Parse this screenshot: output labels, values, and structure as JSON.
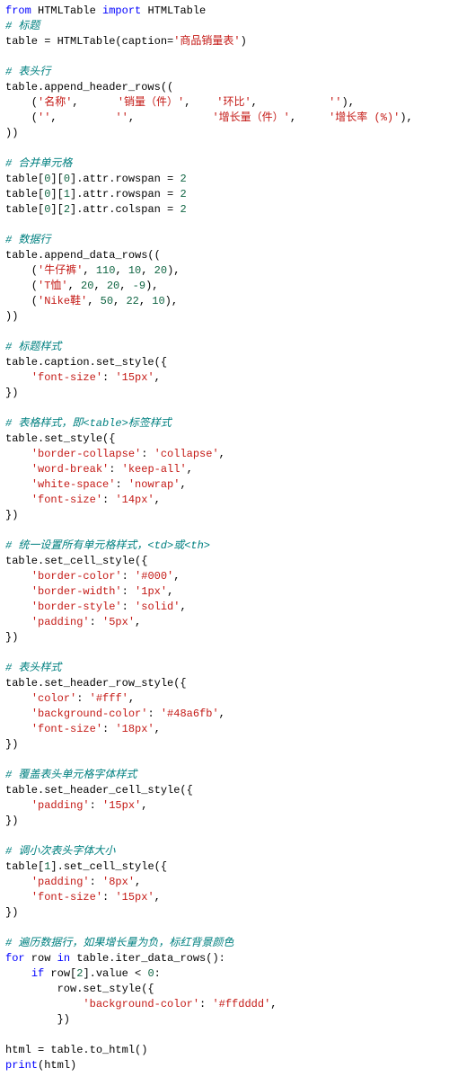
{
  "code": {
    "l1": {
      "kw1": "from",
      "mod": " HTMLTable ",
      "kw2": "import",
      "cls": " HTMLTable"
    },
    "c2": "# 标题",
    "l3": {
      "a": "table = HTMLTable(caption=",
      "s": "'商品销量表'",
      "b": ")"
    },
    "c5": "# 表头行",
    "l6": "table.append_header_rows((",
    "l7": {
      "p": "    (",
      "s1": "'名称'",
      "c1": ",      ",
      "s2": "'销量（件）'",
      "c2": ",    ",
      "s3": "'环比'",
      "c3": ",           ",
      "s4": "''",
      "c4": "),"
    },
    "l8": {
      "p": "    (",
      "s1": "''",
      "c1": ",         ",
      "s2": "''",
      "c2": ",            ",
      "s3": "'增长量（件）'",
      "c3": ",     ",
      "s4": "'增长率 (%)'",
      "c4": "),"
    },
    "l9": "))",
    "c11": "# 合并单元格",
    "l12": {
      "a": "table[",
      "n1": "0",
      "b": "][",
      "n2": "0",
      "c": "].attr.rowspan = ",
      "n3": "2"
    },
    "l13": {
      "a": "table[",
      "n1": "0",
      "b": "][",
      "n2": "1",
      "c": "].attr.rowspan = ",
      "n3": "2"
    },
    "l14": {
      "a": "table[",
      "n1": "0",
      "b": "][",
      "n2": "2",
      "c": "].attr.colspan = ",
      "n3": "2"
    },
    "c16": "# 数据行",
    "l17": "table.append_data_rows((",
    "l18": {
      "p": "    (",
      "s": "'牛仔裤'",
      "c1": ", ",
      "n1": "110",
      "c2": ", ",
      "n2": "10",
      "c3": ", ",
      "n3": "20",
      "e": "),"
    },
    "l19": {
      "p": "    (",
      "s": "'T恤'",
      "c1": ", ",
      "n1": "20",
      "c2": ", ",
      "n2": "20",
      "c3": ", ",
      "n3": "-9",
      "e": "),"
    },
    "l20": {
      "p": "    (",
      "s": "'Nike鞋'",
      "c1": ", ",
      "n1": "50",
      "c2": ", ",
      "n2": "22",
      "c3": ", ",
      "n3": "10",
      "e": "),"
    },
    "l21": "))",
    "c23": "# 标题样式",
    "l24": "table.caption.set_style({",
    "l25": {
      "p": "    ",
      "k": "'font-size'",
      "c": ": ",
      "v": "'15px'",
      "e": ","
    },
    "l26": "})",
    "c28": "# 表格样式，即<table>标签样式",
    "l29": "table.set_style({",
    "l30": {
      "p": "    ",
      "k": "'border-collapse'",
      "c": ": ",
      "v": "'collapse'",
      "e": ","
    },
    "l31": {
      "p": "    ",
      "k": "'word-break'",
      "c": ": ",
      "v": "'keep-all'",
      "e": ","
    },
    "l32": {
      "p": "    ",
      "k": "'white-space'",
      "c": ": ",
      "v": "'nowrap'",
      "e": ","
    },
    "l33": {
      "p": "    ",
      "k": "'font-size'",
      "c": ": ",
      "v": "'14px'",
      "e": ","
    },
    "l34": "})",
    "c36": "# 统一设置所有单元格样式，<td>或<th>",
    "l37": "table.set_cell_style({",
    "l38": {
      "p": "    ",
      "k": "'border-color'",
      "c": ": ",
      "v": "'#000'",
      "e": ","
    },
    "l39": {
      "p": "    ",
      "k": "'border-width'",
      "c": ": ",
      "v": "'1px'",
      "e": ","
    },
    "l40": {
      "p": "    ",
      "k": "'border-style'",
      "c": ": ",
      "v": "'solid'",
      "e": ","
    },
    "l41": {
      "p": "    ",
      "k": "'padding'",
      "c": ": ",
      "v": "'5px'",
      "e": ","
    },
    "l42": "})",
    "c44": "# 表头样式",
    "l45": "table.set_header_row_style({",
    "l46": {
      "p": "    ",
      "k": "'color'",
      "c": ": ",
      "v": "'#fff'",
      "e": ","
    },
    "l47": {
      "p": "    ",
      "k": "'background-color'",
      "c": ": ",
      "v": "'#48a6fb'",
      "e": ","
    },
    "l48": {
      "p": "    ",
      "k": "'font-size'",
      "c": ": ",
      "v": "'18px'",
      "e": ","
    },
    "l49": "})",
    "c51": "# 覆盖表头单元格字体样式",
    "l52": "table.set_header_cell_style({",
    "l53": {
      "p": "    ",
      "k": "'padding'",
      "c": ": ",
      "v": "'15px'",
      "e": ","
    },
    "l54": "})",
    "c56": "# 调小次表头字体大小",
    "l57": {
      "a": "table[",
      "n": "1",
      "b": "].set_cell_style({"
    },
    "l58": {
      "p": "    ",
      "k": "'padding'",
      "c": ": ",
      "v": "'8px'",
      "e": ","
    },
    "l59": {
      "p": "    ",
      "k": "'font-size'",
      "c": ": ",
      "v": "'15px'",
      "e": ","
    },
    "l60": "})",
    "c62": "# 遍历数据行，如果增长量为负，标红背景颜色",
    "l63": {
      "kw1": "for",
      "a": " row ",
      "kw2": "in",
      "b": " table.iter_data_rows():"
    },
    "l64": {
      "p": "    ",
      "kw": "if",
      "a": " row[",
      "n1": "2",
      "b": "].value < ",
      "n2": "0",
      "c": ":"
    },
    "l65": "        row.set_style({",
    "l66": {
      "p": "            ",
      "k": "'background-color'",
      "c": ": ",
      "v": "'#ffdddd'",
      "e": ","
    },
    "l67": "        })",
    "l69": "html = table.to_html()",
    "l70": {
      "fn": "print",
      "a": "(html)"
    }
  }
}
